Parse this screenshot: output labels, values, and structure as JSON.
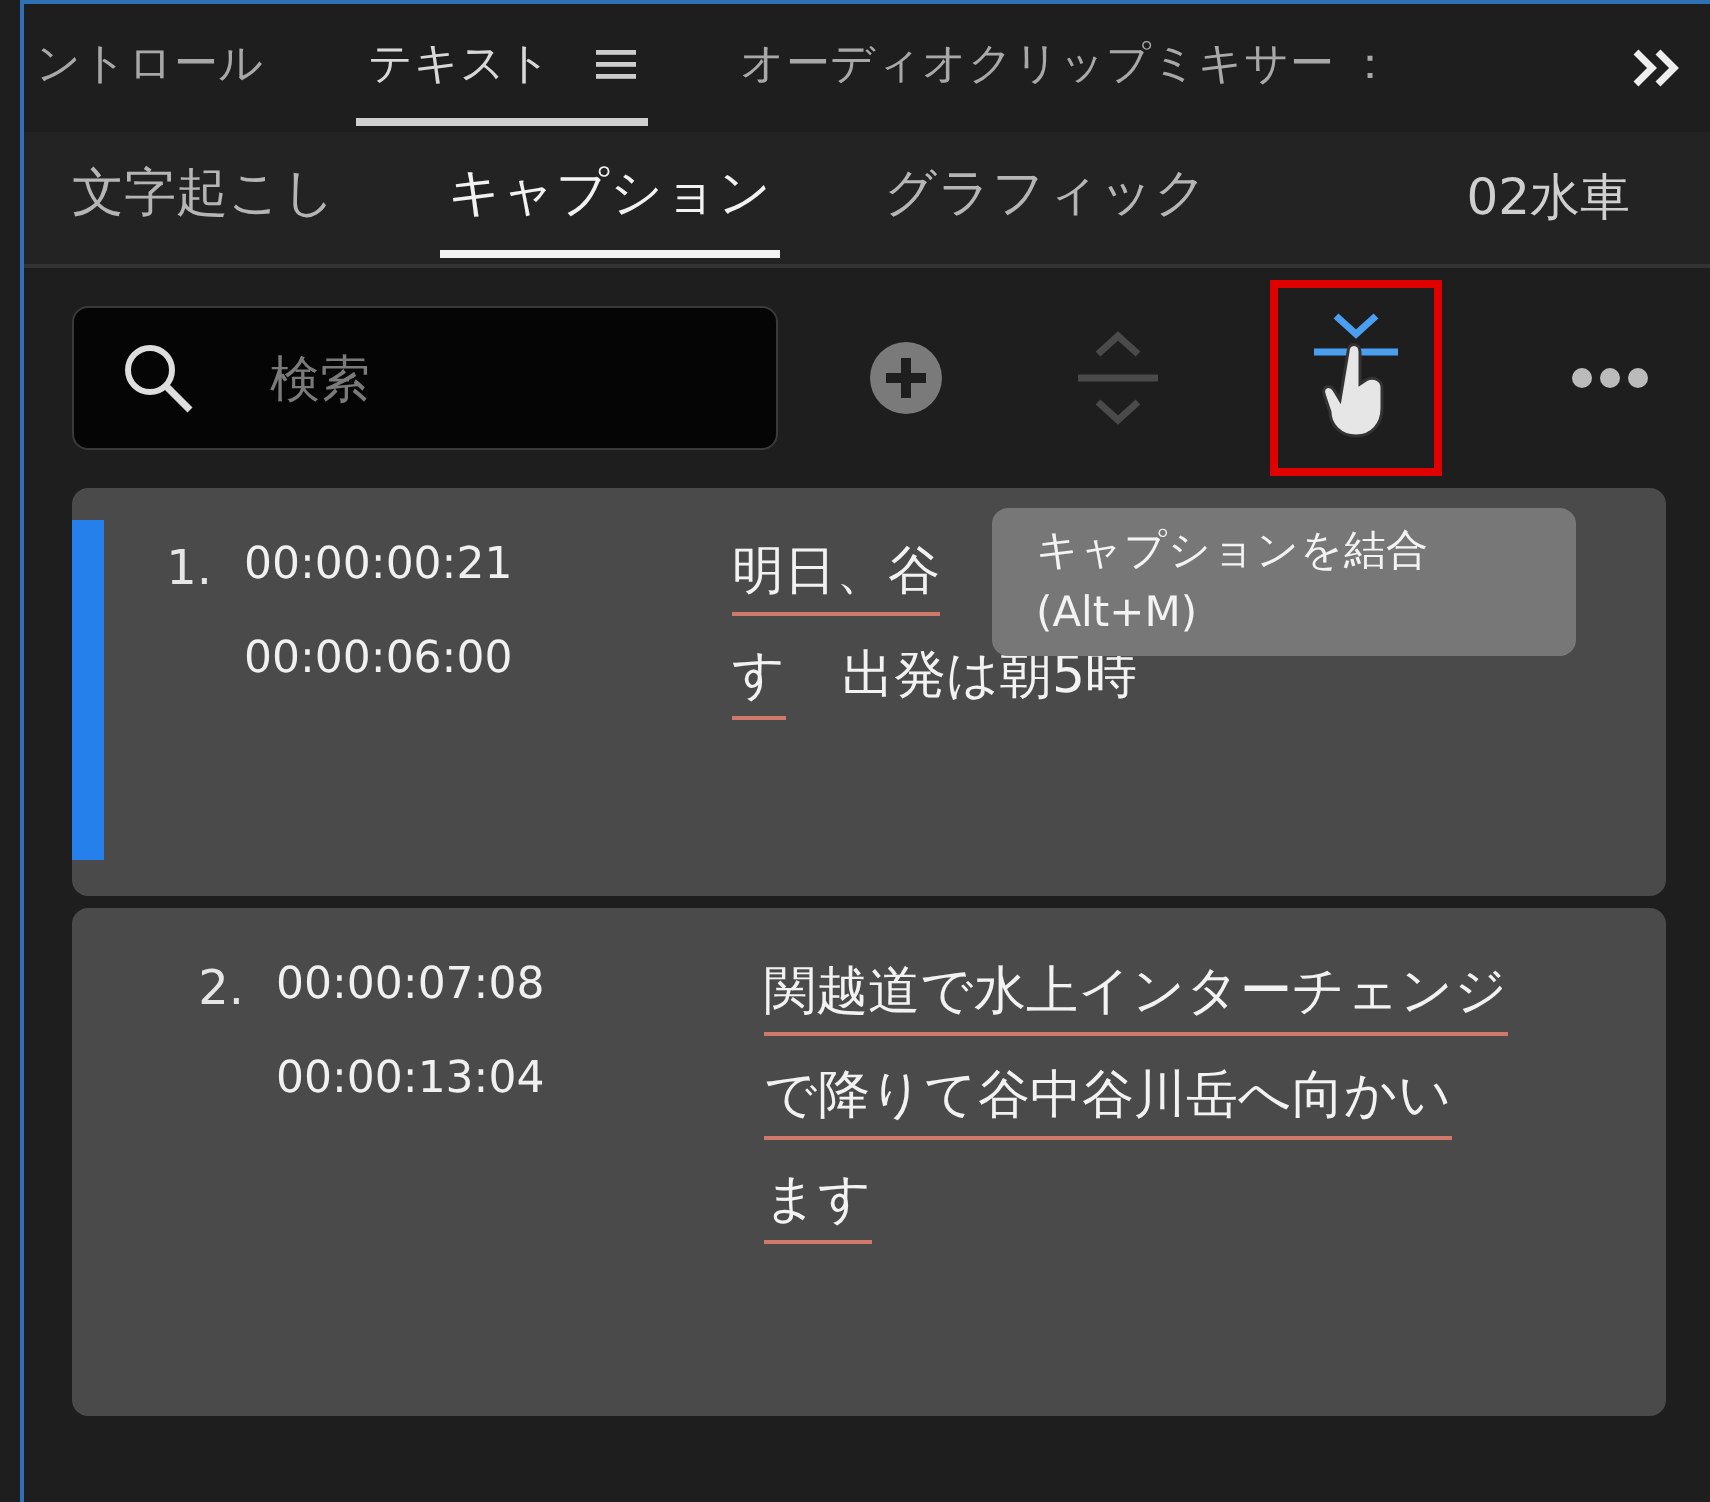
{
  "panel_tabs": [
    {
      "label": "ントロール",
      "selected": false
    },
    {
      "label": "テキスト",
      "selected": true,
      "menu": true
    },
    {
      "label": "オーディオクリップミキサー ：",
      "selected": false
    }
  ],
  "sub_tabs": [
    {
      "label": "文字起こし",
      "selected": false
    },
    {
      "label": "キャプション",
      "selected": true
    },
    {
      "label": "グラフィック",
      "selected": false
    }
  ],
  "sequence_name": "02水車",
  "search": {
    "placeholder": "検索"
  },
  "toolbar": [
    {
      "kind": "add",
      "disabled": false,
      "highlighted": false
    },
    {
      "kind": "split",
      "disabled": true,
      "highlighted": false
    },
    {
      "kind": "merge",
      "disabled": false,
      "highlighted": true
    },
    {
      "kind": "more",
      "disabled": false,
      "highlighted": false
    }
  ],
  "tooltip": {
    "title": "キャプションを結合",
    "shortcut": "(Alt+M)"
  },
  "captions": [
    {
      "number": "1.",
      "start": "00:00:00:21",
      "end": "00:00:06:00",
      "selected": true,
      "lines": [
        [
          {
            "text": "明日、谷",
            "underlined": true
          }
        ],
        [
          {
            "text": "す",
            "underlined": true
          },
          {
            "text": "出発は朝5時",
            "underlined": false
          }
        ]
      ]
    },
    {
      "number": "2.",
      "start": "00:00:07:08",
      "end": "00:00:13:04",
      "selected": false,
      "lines": [
        [
          {
            "text": "関越道で水上インターチェンジ",
            "underlined": true
          }
        ],
        [
          {
            "text": "で降りて谷中谷川岳へ向かい",
            "underlined": true
          }
        ],
        [
          {
            "text": "ます",
            "underlined": true
          }
        ]
      ]
    }
  ]
}
